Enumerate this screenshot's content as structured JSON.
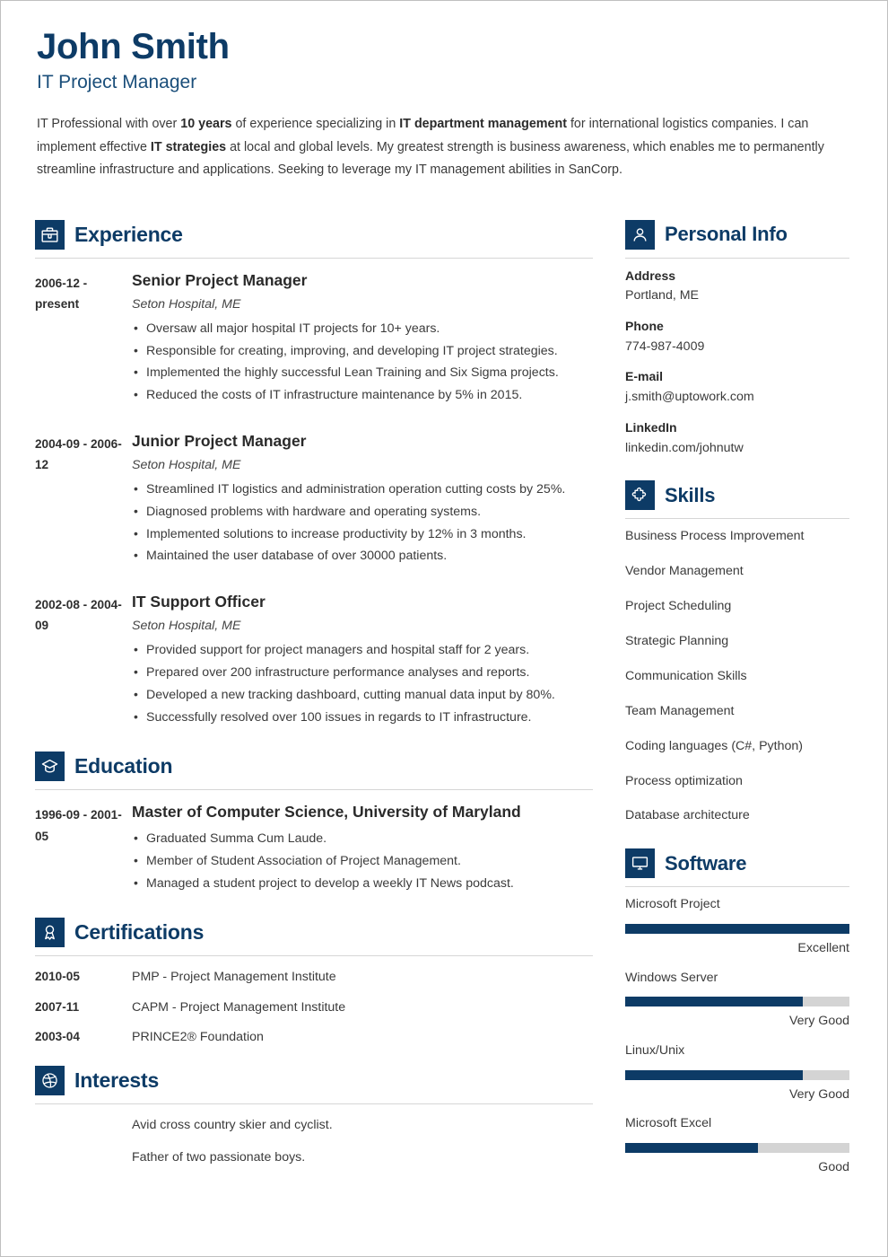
{
  "header": {
    "name": "John Smith",
    "job_title": "IT Project Manager",
    "summary_parts": [
      {
        "text": "IT Professional with over ",
        "bold": false
      },
      {
        "text": "10 years",
        "bold": true
      },
      {
        "text": " of experience specializing in ",
        "bold": false
      },
      {
        "text": "IT department management",
        "bold": true
      },
      {
        "text": " for international logistics companies. I can implement effective ",
        "bold": false
      },
      {
        "text": "IT strategies",
        "bold": true
      },
      {
        "text": " at local and global levels. My greatest strength is business awareness, which enables me to permanently streamline infrastructure and applications. Seeking to leverage my IT management abilities in SanCorp.",
        "bold": false
      }
    ]
  },
  "theme": {
    "accent": "#0d3b66",
    "text": "#3b3b3b",
    "rule": "#d6d6d6",
    "bar_track": "#d4d4d4"
  },
  "sections": {
    "experience": {
      "title": "Experience",
      "icon": "briefcase-icon",
      "entries": [
        {
          "date": "2006-12 - present",
          "role": "Senior Project Manager",
          "org": "Seton Hospital, ME",
          "bullets": [
            "Oversaw all major hospital IT projects for 10+ years.",
            "Responsible for creating, improving, and developing IT project strategies.",
            "Implemented the highly successful Lean Training and Six Sigma projects.",
            "Reduced the costs of IT infrastructure maintenance by 5% in 2015."
          ]
        },
        {
          "date": "2004-09 - 2006-12",
          "role": "Junior Project Manager",
          "org": "Seton Hospital, ME",
          "bullets": [
            "Streamlined IT logistics and administration operation cutting costs by 25%.",
            "Diagnosed problems with hardware and operating systems.",
            "Implemented solutions to increase productivity by 12% in 3 months.",
            "Maintained the user database of over 30000 patients."
          ]
        },
        {
          "date": "2002-08 - 2004-09",
          "role": "IT Support Officer",
          "org": "Seton Hospital, ME",
          "bullets": [
            "Provided support for project managers and hospital staff for 2 years.",
            "Prepared over 200 infrastructure performance analyses and reports.",
            "Developed a new tracking dashboard, cutting manual data input by 80%.",
            "Successfully resolved over 100 issues in regards to IT infrastructure."
          ]
        }
      ]
    },
    "education": {
      "title": "Education",
      "icon": "graduation-cap-icon",
      "entries": [
        {
          "date": "1996-09 - 2001-05",
          "degree": "Master of Computer Science, University of Maryland",
          "bullets": [
            "Graduated Summa Cum Laude.",
            "Member of Student Association of Project Management.",
            "Managed a student project to develop a weekly IT News podcast."
          ]
        }
      ]
    },
    "certifications": {
      "title": "Certifications",
      "icon": "award-ribbon-icon",
      "rows": [
        {
          "date": "2010-05",
          "text": "PMP - Project Management Institute"
        },
        {
          "date": "2007-11",
          "text": "CAPM - Project Management Institute"
        },
        {
          "date": "2003-04",
          "text": "PRINCE2® Foundation"
        }
      ]
    },
    "interests": {
      "title": "Interests",
      "icon": "ball-icon",
      "items": [
        "Avid cross country skier and cyclist.",
        "Father of two passionate boys."
      ]
    },
    "personal_info": {
      "title": "Personal Info",
      "icon": "person-icon",
      "fields": [
        {
          "label": "Address",
          "value": "Portland, ME"
        },
        {
          "label": "Phone",
          "value": "774-987-4009"
        },
        {
          "label": "E-mail",
          "value": "j.smith@uptowork.com"
        },
        {
          "label": "LinkedIn",
          "value": "linkedin.com/johnutw"
        }
      ]
    },
    "skills": {
      "title": "Skills",
      "icon": "puzzle-piece-icon",
      "items": [
        "Business Process Improvement",
        "Vendor Management",
        "Project Scheduling",
        "Strategic Planning",
        "Communication Skills",
        "Team Management",
        "Coding languages (C#, Python)",
        "Process optimization",
        "Database architecture"
      ]
    },
    "software": {
      "title": "Software",
      "icon": "monitor-icon",
      "items": [
        {
          "name": "Microsoft Project",
          "level": "Excellent",
          "percent": 100
        },
        {
          "name": "Windows Server",
          "level": "Very Good",
          "percent": 79
        },
        {
          "name": "Linux/Unix",
          "level": "Very Good",
          "percent": 79
        },
        {
          "name": "Microsoft Excel",
          "level": "Good",
          "percent": 59
        }
      ]
    }
  }
}
